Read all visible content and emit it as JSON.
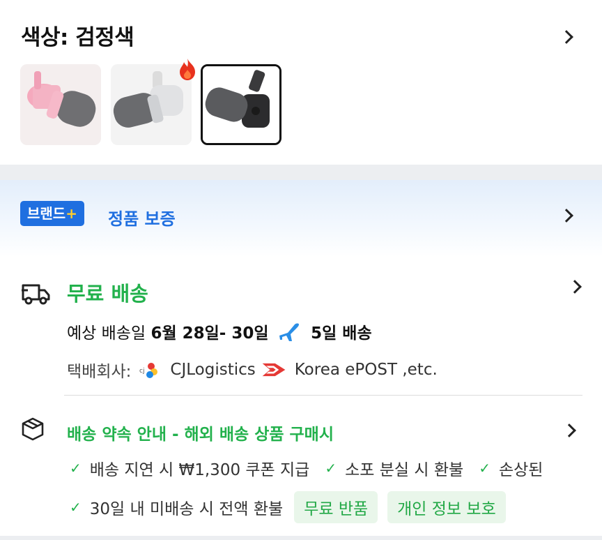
{
  "color": {
    "title": "색상: 검정색",
    "options": [
      {
        "name": "pink",
        "selected": false,
        "hot": false
      },
      {
        "name": "silver",
        "selected": false,
        "hot": true
      },
      {
        "name": "black",
        "selected": true,
        "hot": false
      }
    ]
  },
  "brand": {
    "badge": "브랜드",
    "badge_plus": "+",
    "text": "정품 보증"
  },
  "shipping": {
    "title": "무료 배송",
    "eta_prefix": "예상 배송일",
    "eta_dates": "6월 28일- 30일",
    "eta_days": "5일 배송",
    "courier_label": "택배회사:",
    "courier_1": "CJLogistics",
    "courier_2": "Korea ePOST ,etc."
  },
  "promise": {
    "title": "배송 약속 안내 - 해외 배송 상품 구매시",
    "items_row1": [
      "배송 지연 시 ₩1,300 쿠폰 지급",
      "소포 분실 시 환불",
      "손상된"
    ],
    "items_row2": [
      "30일 내 미배송 시 전액 환불"
    ],
    "pills": [
      "무료 반품",
      "개인 정보 보호"
    ]
  },
  "colors": {
    "green": "#22b14c",
    "blue": "#1f6fe0"
  }
}
